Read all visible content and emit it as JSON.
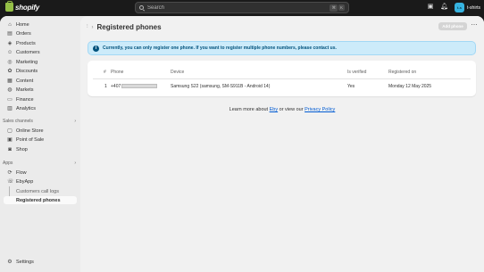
{
  "topbar": {
    "logo_text": "shopify",
    "search_placeholder": "Search",
    "shortcut_keys": [
      "⌘",
      "K"
    ],
    "store_avatar": "t-s",
    "store_name": "t-shirts"
  },
  "sidebar": {
    "main_items": [
      {
        "label": "Home",
        "icon": "home-icon"
      },
      {
        "label": "Orders",
        "icon": "orders-icon"
      },
      {
        "label": "Products",
        "icon": "products-icon"
      },
      {
        "label": "Customers",
        "icon": "customers-icon"
      },
      {
        "label": "Marketing",
        "icon": "marketing-icon"
      },
      {
        "label": "Discounts",
        "icon": "discounts-icon"
      },
      {
        "label": "Content",
        "icon": "content-icon"
      },
      {
        "label": "Markets",
        "icon": "markets-icon"
      },
      {
        "label": "Finance",
        "icon": "finance-icon"
      },
      {
        "label": "Analytics",
        "icon": "analytics-icon"
      }
    ],
    "sales_channels_heading": "Sales channels",
    "sales_channels": [
      {
        "label": "Online Store",
        "icon": "online-store-icon"
      },
      {
        "label": "Point of Sale",
        "icon": "point-of-sale-icon"
      },
      {
        "label": "Shop",
        "icon": "shop-icon"
      }
    ],
    "apps_heading": "Apps",
    "apps": [
      {
        "label": "Flow",
        "icon": "flow-icon"
      },
      {
        "label": "EbyApp",
        "icon": "app-icon"
      }
    ],
    "app_subitems": [
      {
        "label": "Customers call logs"
      },
      {
        "label": "Registered phones"
      }
    ],
    "settings_label": "Settings"
  },
  "page": {
    "title": "Registered phones",
    "add_button": "Add phone",
    "more_icon": "more-icon",
    "banner_text": "Currently, you can only register one phone. If you want to register multiple phone numbers, please contact us.",
    "table": {
      "headers": [
        "#",
        "Phone",
        "Device",
        "Is verified",
        "Registered on"
      ],
      "rows": [
        {
          "index": "1",
          "phone": "+407",
          "device": "Samsung S22 (samsung, SM-S911B - Android 14)",
          "verified": "Yes",
          "registered_on": "Monday 12 May 2025"
        }
      ]
    },
    "footer": {
      "prefix": "Learn more about",
      "link1": "Eby",
      "middle": "or view our",
      "link2": "Privacy Policy"
    }
  },
  "colors": {
    "accent_link": "#005bd3",
    "banner_bg": "#ccebfa",
    "banner_text": "#00527c"
  }
}
